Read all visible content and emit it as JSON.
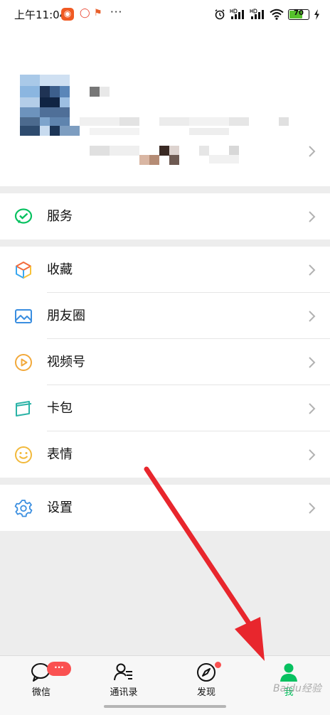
{
  "status_bar": {
    "time": "上午11:04",
    "more": "···",
    "battery_level": "70",
    "battery_fraction": 0.7
  },
  "profile": {
    "blurred": true
  },
  "menu": {
    "service": {
      "label": "服务",
      "icon": "wechat-pay-icon"
    },
    "items": [
      {
        "label": "收藏",
        "icon": "favorites-cube-icon"
      },
      {
        "label": "朋友圈",
        "icon": "moments-photo-icon"
      },
      {
        "label": "视频号",
        "icon": "channels-play-icon"
      },
      {
        "label": "卡包",
        "icon": "card-wallet-icon"
      },
      {
        "label": "表情",
        "icon": "sticker-smile-icon"
      }
    ],
    "settings": {
      "label": "设置",
      "icon": "gear-icon"
    }
  },
  "tabbar": {
    "tabs": [
      {
        "label": "微信",
        "icon": "chat-bubble-icon",
        "badge": "···"
      },
      {
        "label": "通讯录",
        "icon": "contacts-icon"
      },
      {
        "label": "发现",
        "icon": "compass-icon"
      },
      {
        "label": "我",
        "icon": "person-icon",
        "active": true
      }
    ]
  },
  "watermark": "Baidu经验",
  "colors": {
    "accent": "#07c160",
    "badge": "#fa5151",
    "arrow": "#e8262d",
    "background": "#ededed"
  }
}
